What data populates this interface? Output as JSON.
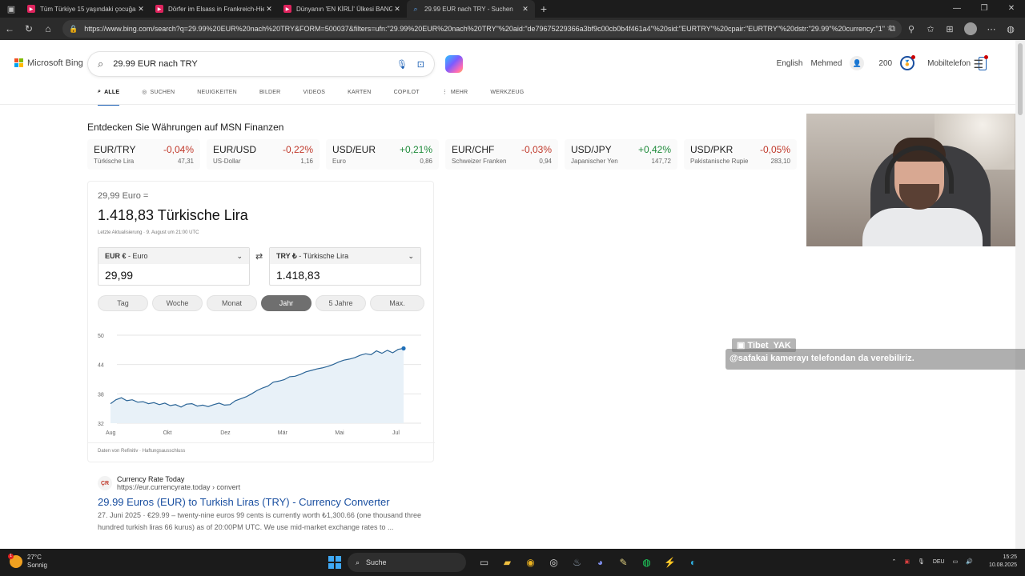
{
  "browser": {
    "tabs": [
      {
        "title": "Tüm Türkiye 15 yaşındaki çocuğa",
        "close": "✕"
      },
      {
        "title": "Dörfer im Elsass in Frankreich-Hie",
        "close": "✕"
      },
      {
        "title": "Dünyanın 'EN KİRLİ' Ülkesi BANG",
        "close": "✕"
      },
      {
        "title": "29.99 EUR nach TRY - Suchen",
        "close": "✕"
      }
    ],
    "url": "https://www.bing.com/search?q=29.99%20EUR%20nach%20TRY&FORM=500037&filters=ufn:\"29.99%20EUR%20nach%20TRY\"%20aid:\"de79675229366a3bf9c00cb0b4f461a4\"%20sid:\"EURTRY\"%20cpair:\"EURTRY\"%20dstr:\"29.99\"%20currency:\"1\""
  },
  "header": {
    "logo_text": "Microsoft Bing",
    "search_value": "29.99 EUR nach TRY",
    "lang": "English",
    "user": "Mehmed",
    "points": "200",
    "mobile": "Mobiltelefon"
  },
  "nav": {
    "tabs": [
      "ALLE",
      "SUCHEN",
      "NEUIGKEITEN",
      "BILDER",
      "VIDEOS",
      "KARTEN",
      "COPILOT",
      "MEHR",
      "WERKZEUG"
    ]
  },
  "finance": {
    "heading": "Entdecken Sie Währungen auf MSN Finanzen",
    "pairs": [
      {
        "pair": "EUR/TRY",
        "change": "-0,04%",
        "name": "Türkische Lira",
        "rate": "47,31"
      },
      {
        "pair": "EUR/USD",
        "change": "-0,22%",
        "name": "US-Dollar",
        "rate": "1,16"
      },
      {
        "pair": "USD/EUR",
        "change": "+0,21%",
        "name": "Euro",
        "rate": "0,86"
      },
      {
        "pair": "EUR/CHF",
        "change": "-0,03%",
        "name": "Schweizer Franken",
        "rate": "0,94"
      },
      {
        "pair": "USD/JPY",
        "change": "+0,42%",
        "name": "Japanischer Yen",
        "rate": "147,72"
      },
      {
        "pair": "USD/PKR",
        "change": "-0,05%",
        "name": "Pakistanische Rupie",
        "rate": "283,10"
      }
    ]
  },
  "converter": {
    "from_line": "29,99 Euro =",
    "result": "1.418,83 Türkische Lira",
    "updated": "Letzte Aktualisierung · 9. August um 21:00 UTC",
    "from_code": "EUR €",
    "from_name": " - Euro",
    "from_value": "29,99",
    "to_code": "TRY ₺",
    "to_name": " - Türkische Lira",
    "to_value": "1.418,83",
    "ranges": [
      "Tag",
      "Woche",
      "Monat",
      "Jahr",
      "5 Jahre",
      "Max."
    ],
    "source": "Daten von Refinitiv · Haftungsausschluss"
  },
  "chart_data": {
    "type": "area",
    "x_ticks": [
      "Aug",
      "Okt",
      "Dez",
      "Mär",
      "Mai",
      "Jul"
    ],
    "y_ticks": [
      50,
      44,
      38,
      32
    ],
    "ylim": [
      32,
      50
    ],
    "series": [
      {
        "values": [
          36.0,
          36.8,
          37.2,
          36.6,
          36.8,
          36.3,
          36.4,
          36.0,
          36.2,
          35.8,
          36.1,
          35.6,
          35.8,
          35.3,
          35.9,
          36.0,
          35.5,
          35.7,
          35.4,
          35.8,
          36.1,
          35.7,
          35.8,
          36.6,
          37.0,
          37.4,
          38.0,
          38.7,
          39.2,
          39.6,
          40.4,
          40.6,
          40.9,
          41.5,
          41.6,
          42.0,
          42.5,
          42.8,
          43.1,
          43.3,
          43.6,
          44.0,
          44.5,
          44.9,
          45.1,
          45.4,
          45.9,
          46.2,
          46.0,
          46.8,
          46.3,
          46.9,
          46.4,
          47.1,
          47.3
        ],
        "color": "#2a6496"
      }
    ]
  },
  "result": {
    "site_name": "Currency Rate Today",
    "site_url": "https://eur.currencyrate.today › convert",
    "favicon": "ÇR",
    "title": "29.99 Euros (EUR) to Turkish Liras (TRY) - Currency Converter",
    "snippet": "27. Juni 2025 · €29.99 – twenty-nine euros 99 cents is currently worth ₺1,300.66 (one thousand three hundred turkish liras 66 kurus) as of 20:00PM UTC. We use mid-market exchange rates to ..."
  },
  "overlay": {
    "chat_user": "Tibet_YAK",
    "chat_text": "@safakai kamerayı telefondan da verebiliriz."
  },
  "taskbar": {
    "temp": "27°C",
    "weather": "Sonnig",
    "search": "Suche",
    "lang": "DEU",
    "time": "15:25",
    "date": "10.08.2025"
  },
  "colors": {
    "negative": "#c0392b",
    "positive": "#1e8a3a",
    "link": "#1a4fa0"
  }
}
